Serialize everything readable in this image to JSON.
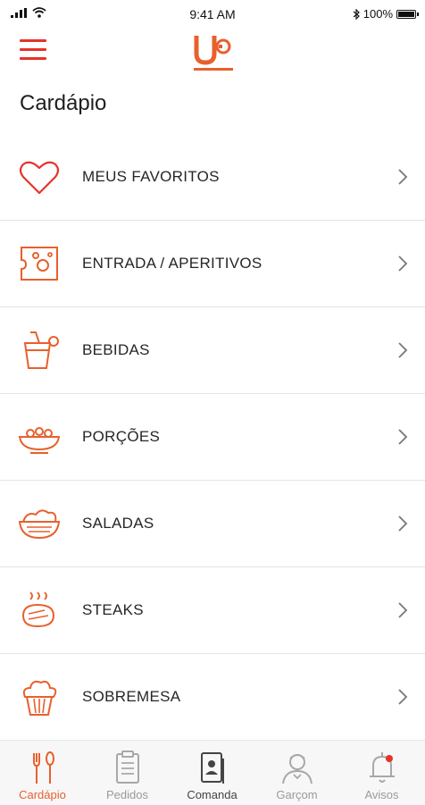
{
  "status_bar": {
    "time": "9:41 AM",
    "battery": "100%"
  },
  "header": {
    "title": "Cardápio"
  },
  "colors": {
    "accent": "#e8602c",
    "menu_red": "#e6332a"
  },
  "menu": [
    {
      "label": "MEUS FAVORITOS",
      "icon": "heart-icon"
    },
    {
      "label": "ENTRADA / APERITIVOS",
      "icon": "cheese-icon"
    },
    {
      "label": "BEBIDAS",
      "icon": "drink-icon"
    },
    {
      "label": "PORÇÕES",
      "icon": "bowl-icon"
    },
    {
      "label": "SALADAS",
      "icon": "salad-icon"
    },
    {
      "label": "STEAKS",
      "icon": "steak-icon"
    },
    {
      "label": "SOBREMESA",
      "icon": "cupcake-icon"
    }
  ],
  "tabs": [
    {
      "label": "Cardápio",
      "icon": "cutlery-icon",
      "active": true
    },
    {
      "label": "Pedidos",
      "icon": "clipboard-icon"
    },
    {
      "label": "Comanda",
      "icon": "bill-icon"
    },
    {
      "label": "Garçom",
      "icon": "waiter-icon"
    },
    {
      "label": "Avisos",
      "icon": "bell-icon"
    }
  ]
}
